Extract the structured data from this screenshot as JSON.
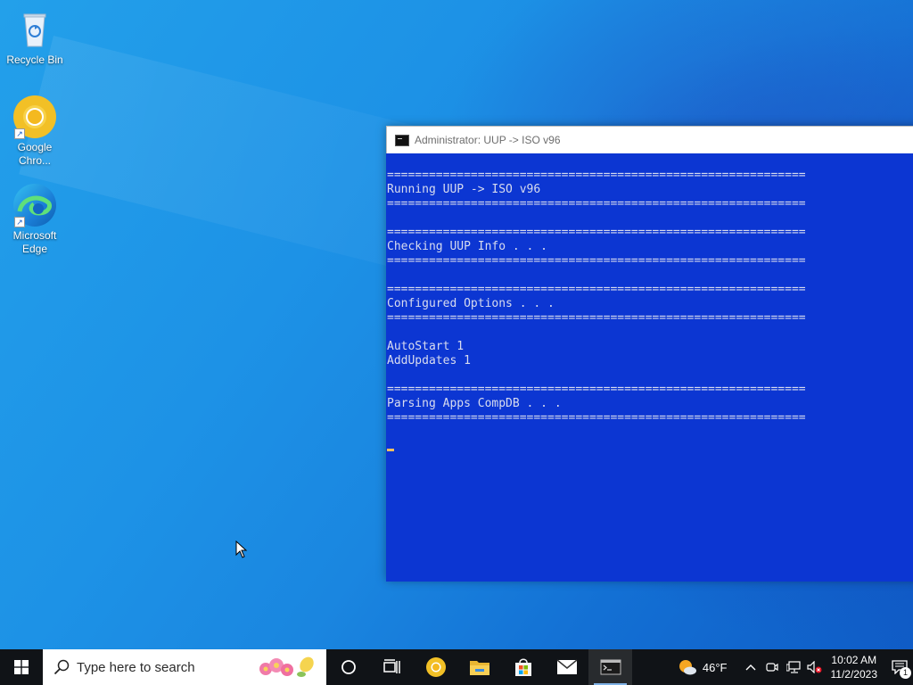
{
  "desktop": {
    "icons": [
      {
        "label": "Recycle Bin",
        "icon": "recycle-bin-icon"
      },
      {
        "label": "Google Chro...",
        "icon": "chrome-icon"
      },
      {
        "label": "Microsoft Edge",
        "icon": "edge-icon"
      }
    ]
  },
  "console": {
    "title": "Administrator:  UUP -> ISO v96",
    "lines": [
      "============================================================",
      "Running UUP -> ISO v96",
      "============================================================",
      "",
      "============================================================",
      "Checking UUP Info . . .",
      "============================================================",
      "",
      "============================================================",
      "Configured Options . . .",
      "============================================================",
      "",
      "AutoStart 1",
      "AddUpdates 1",
      "",
      "============================================================",
      "Parsing Apps CompDB . . .",
      "============================================================"
    ],
    "colors": {
      "background": "#0c36d2",
      "text": "#d8dcef"
    }
  },
  "taskbar": {
    "search_placeholder": "Type here to search",
    "pinned": [
      "cortana-icon",
      "task-view-icon",
      "chrome-icon",
      "file-explorer-icon",
      "store-icon",
      "mail-icon",
      "terminal-icon"
    ],
    "active": "terminal-icon",
    "weather": {
      "temp": "46°F",
      "icon": "partly-cloudy-icon"
    },
    "clock": {
      "time": "10:02 AM",
      "date": "11/2/2023"
    },
    "notifications": {
      "count": "1"
    }
  }
}
